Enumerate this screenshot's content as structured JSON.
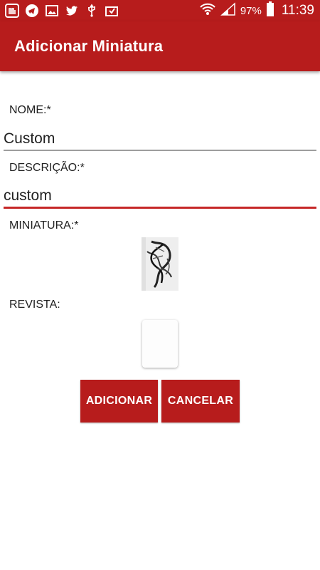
{
  "status_bar": {
    "battery": "97%",
    "time": "11:39",
    "icons_left": [
      "app-icon",
      "telegram-icon",
      "gallery-icon",
      "twitter-icon",
      "usb-icon",
      "download-icon"
    ],
    "icons_right": [
      "wifi-icon",
      "signal-icon",
      "battery-icon"
    ]
  },
  "app_bar": {
    "title": "Adicionar Miniatura"
  },
  "form": {
    "nome_label": "NOME:*",
    "nome_value": "Custom",
    "descricao_label": "DESCRIÇÃO:*",
    "descricao_value": "custom",
    "miniatura_label": "MINIATURA:*",
    "revista_label": "REVISTA:"
  },
  "buttons": {
    "add": "ADICIONAR",
    "cancel": "CANCELAR"
  },
  "colors": {
    "primary": "#b71c1c",
    "focused_line": "#c62828",
    "inactive_line": "#9e9e9e"
  }
}
